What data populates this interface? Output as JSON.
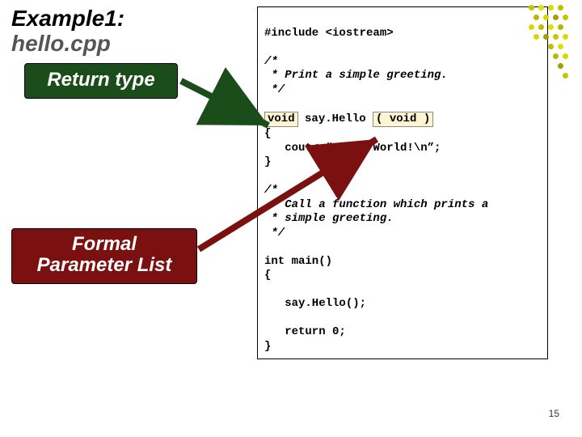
{
  "title": {
    "line1": "Example1:",
    "line2": "hello.cpp"
  },
  "labels": {
    "return_type": "Return type",
    "formal_param": "Formal\nParameter List"
  },
  "code": {
    "include": "#include <iostream>",
    "comment1_l1": "/*",
    "comment1_l2": " * Print a simple greeting.",
    "comment1_l3": " */",
    "fn_void1": "void",
    "fn_name": " say.Hello ",
    "fn_void2": "( void )",
    "fn_open": "{",
    "fn_body": "   cout<<“Hello World!\\n”;",
    "fn_close": "}",
    "comment2_l1": "/*",
    "comment2_l2": " * Call a function which prints a",
    "comment2_l3": " * simple greeting.",
    "comment2_l4": " */",
    "main_sig": "int main()",
    "main_open": "{",
    "main_call": "   say.Hello();",
    "main_ret": "   return 0;",
    "main_close": "}"
  },
  "page_number": "15",
  "decor_colors": [
    "#c6c600",
    "#e0e000",
    "#dada00",
    "#c0c000",
    "#b8b800",
    "#d8d800",
    "#a0a000"
  ]
}
